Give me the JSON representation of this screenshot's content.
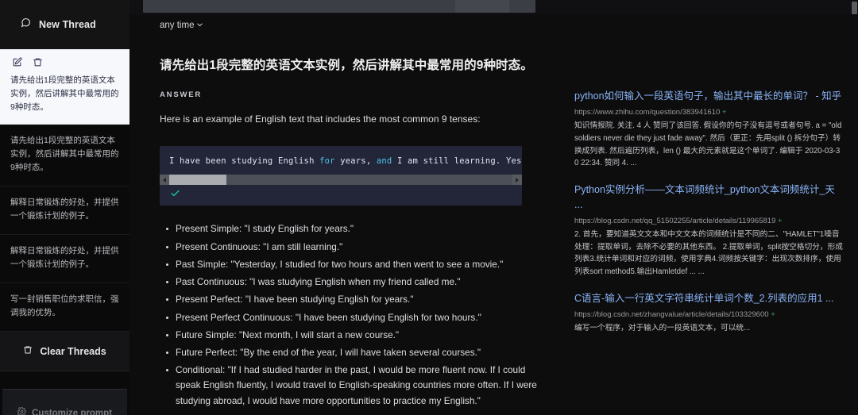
{
  "sidebar": {
    "new_thread_label": "New Thread",
    "active_thread": {
      "text": "请先给出1段完整的英语文本实例，然后讲解其中最常用的9种时态。"
    },
    "threads": [
      {
        "text": "请先给出1段完整的英语文本实例，然后讲解其中最常用的9种时态。"
      },
      {
        "text": "解释日常锻炼的好处，并提供一个锻炼计划的例子。"
      },
      {
        "text": "解释日常锻炼的好处，并提供一个锻炼计划的例子。"
      },
      {
        "text": "写一封销售职位的求职信，强调我的优势。"
      }
    ],
    "clear_threads_label": "Clear Threads",
    "footer_label": "Customize prompt"
  },
  "toolbar": {
    "time_filter_label": "any time"
  },
  "answer": {
    "question": "请先给出1段完整的英语文本实例，然后讲解其中最常用的9种时态。",
    "answer_label": "ANSWER",
    "intro": "Here is an example of English text that includes the most common 9 tenses:",
    "code": {
      "segments": [
        {
          "text": "I have been studying English ",
          "type": "plain"
        },
        {
          "text": "for",
          "type": "keyword"
        },
        {
          "text": " years, ",
          "type": "plain"
        },
        {
          "text": "and",
          "type": "keyword"
        },
        {
          "text": " I am still learning. Yesterday, I st",
          "type": "plain"
        }
      ],
      "full_text": "I have been studying English for years, and I am still learning. Yesterday, I st"
    },
    "tenses": [
      "Present Simple: \"I study English for years.\"",
      "Present Continuous: \"I am still learning.\"",
      "Past Simple: \"Yesterday, I studied for two hours and then went to see a movie.\"",
      "Past Continuous: \"I was studying English when my friend called me.\"",
      "Present Perfect: \"I have been studying English for years.\"",
      "Present Perfect Continuous: \"I have been studying English for two hours.\"",
      "Future Simple: \"Next month, I will start a new course.\"",
      "Future Perfect: \"By the end of the year, I will have taken several courses.\"",
      "Conditional: \"If I had studied harder in the past, I would be more fluent now. If I could speak English fluently, I would travel to English-speaking countries more often. If I were studying abroad, I would have more opportunities to practice my English.\""
    ]
  },
  "results": [
    {
      "title": "python如何输入一段英语句子，输出其中最长的单词？ - 知乎",
      "url": "https://www.zhihu.com/question/383941610",
      "snippet": "知识情报院. 关注. 4 人 赞同了该回答. 假设你的句子没有逗号或者句号. a = \"old soldiers never die they just fade away\". 然后（更正：先用split () 拆分句子）转换成列表. 然后遍历列表，len () 最大的元素就是这个单词了. 编辑于 2020-03-30 22:34. 赞同 4. ..."
    },
    {
      "title": "Python实例分析——文本词频统计_python文本词频统计_天 ...",
      "url": "https://blog.csdn.net/qq_51502255/article/details/119965819",
      "snippet": "2. 首先，要知道英文文本和中文文本的词频统计是不同的二、\"HAMLET\"1噪音处理：提取单词，去除不必要的其他东西。 2.提取单词，split按空格切分，形成列表3.统计单词和对应的词频，使用字典4.词频按关键字：出现次数排序，使用列表sort method5.输出Hamletdef ... ..."
    },
    {
      "title": "C语言-输入一行英文字符串统计单词个数_2.列表的应用1 ...",
      "url": "https://blog.csdn.net/zhangvalue/article/details/103329600",
      "snippet": "编写一个程序，对于输入的一段英语文本，可以统..."
    }
  ],
  "colors": {
    "accent_link": "#8ab4f8",
    "code_bg": "#222638",
    "code_keyword": "#4fc3e8",
    "check_green": "#19c9a4",
    "active_thread_bg": "#f7f8fb"
  }
}
